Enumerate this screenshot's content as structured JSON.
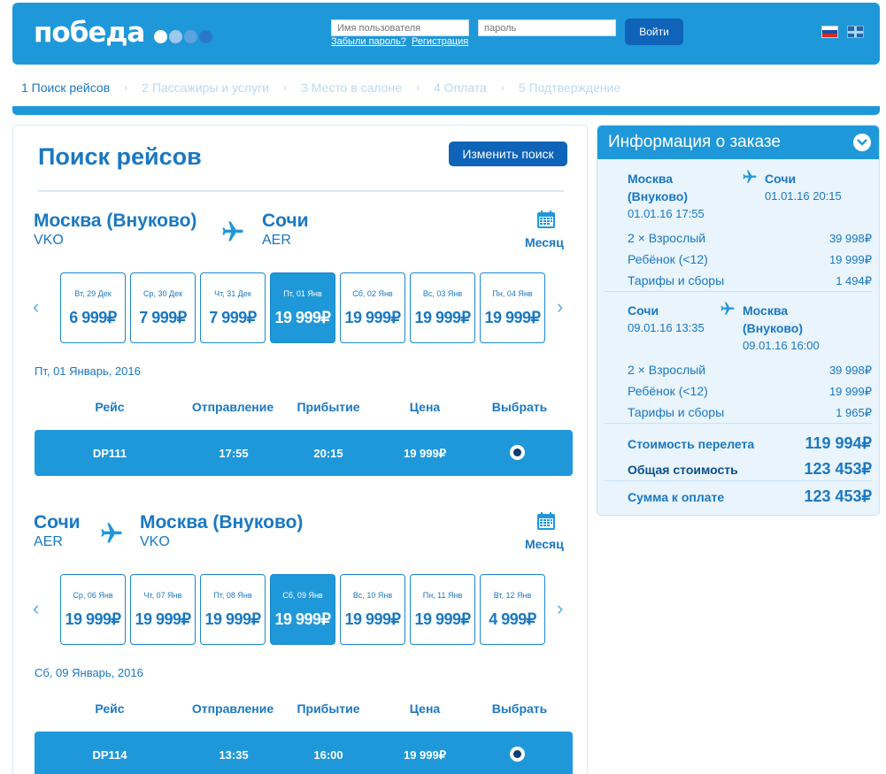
{
  "header": {
    "logo_text": "победа",
    "logo_dot_colors": [
      "#ffffff",
      "#9cc9ee",
      "#5aa3df",
      "#2a79c8"
    ],
    "username_placeholder": "Имя пользователя",
    "password_placeholder": "пароль",
    "forgot_link": "Забыли пароль?",
    "register_link": "Регистрация",
    "login_button": "Войти"
  },
  "steps": [
    {
      "label": "1 Поиск рейсов",
      "active": true
    },
    {
      "label": "2 Пассажиры и услуги",
      "active": false
    },
    {
      "label": "3 Место в салоне",
      "active": false
    },
    {
      "label": "4 Оплата",
      "active": false
    },
    {
      "label": "5 Подтверждение",
      "active": false
    }
  ],
  "main": {
    "title": "Поиск рейсов",
    "change_search_button": "Изменить поиск",
    "column_headers": {
      "flight": "Рейс",
      "departure": "Отправление",
      "arrival": "Прибытие",
      "price": "Цена",
      "select": "Выбрать"
    },
    "routes": [
      {
        "from_city": "Москва (Внуково)",
        "from_code": "VKO",
        "to_city": "Сочи",
        "to_code": "AER",
        "calendar_label": "Месяц",
        "days": [
          {
            "date": "Вт, 29 Дек",
            "price": "6 999₽",
            "selected": false
          },
          {
            "date": "Ср, 30 Дек",
            "price": "7 999₽",
            "selected": false
          },
          {
            "date": "Чт, 31 Дек",
            "price": "7 999₽",
            "selected": false
          },
          {
            "date": "Пт, 01 Янв",
            "price": "19 999₽",
            "selected": true
          },
          {
            "date": "Сб, 02 Янв",
            "price": "19 999₽",
            "selected": false
          },
          {
            "date": "Вс, 03 Янв",
            "price": "19 999₽",
            "selected": false
          },
          {
            "date": "Пн, 04 Янв",
            "price": "19 999₽",
            "selected": false
          }
        ],
        "selected_date": "Пт, 01 Январь, 2016",
        "flight": {
          "number": "DP111",
          "departure": "17:55",
          "arrival": "20:15",
          "price": "19 999₽"
        }
      },
      {
        "from_city": "Сочи",
        "from_code": "AER",
        "to_city": "Москва (Внуково)",
        "to_code": "VKO",
        "calendar_label": "Месяц",
        "days": [
          {
            "date": "Ср, 06 Янв",
            "price": "19 999₽",
            "selected": false
          },
          {
            "date": "Чт, 07 Янв",
            "price": "19 999₽",
            "selected": false
          },
          {
            "date": "Пт, 08 Янв",
            "price": "19 999₽",
            "selected": false
          },
          {
            "date": "Сб, 09 Янв",
            "price": "19 999₽",
            "selected": true
          },
          {
            "date": "Вс, 10 Янв",
            "price": "19 999₽",
            "selected": false
          },
          {
            "date": "Пн, 11 Янв",
            "price": "19 999₽",
            "selected": false
          },
          {
            "date": "Вт, 12 Янв",
            "price": "4 999₽",
            "selected": false
          }
        ],
        "selected_date": "Сб, 09 Январь, 2016",
        "flight": {
          "number": "DP114",
          "departure": "13:35",
          "arrival": "16:00",
          "price": "19 999₽"
        }
      }
    ]
  },
  "order": {
    "title": "Информация о заказе",
    "legs": [
      {
        "from_city_1": "Москва",
        "from_city_2": "(Внуково)",
        "from_datetime": "01.01.16 17:55",
        "to_city_1": "Сочи",
        "to_city_2": "",
        "to_datetime": "01.01.16 20:15",
        "rows": [
          {
            "label": "2 × Взрослый",
            "value": "39 998₽"
          },
          {
            "label": "Ребёнок (<12)",
            "value": "19 999₽"
          },
          {
            "label": "Тарифы и сборы",
            "value": "1 494₽"
          }
        ]
      },
      {
        "from_city_1": "Сочи",
        "from_city_2": "",
        "from_datetime": "09.01.16 13:35",
        "to_city_1": "Москва",
        "to_city_2": "(Внуково)",
        "to_datetime": "09.01.16 16:00",
        "rows": [
          {
            "label": "2 × Взрослый",
            "value": "39 998₽"
          },
          {
            "label": "Ребёнок (<12)",
            "value": "19 999₽"
          },
          {
            "label": "Тарифы и сборы",
            "value": "1 965₽"
          }
        ]
      }
    ],
    "flight_cost_label": "Стоимость перелета",
    "flight_cost_value": "119 994₽",
    "total_label": "Общая стоимость",
    "total_value": "123 453₽",
    "to_pay_label": "Сумма к оплате",
    "to_pay_value": "123 453₽"
  },
  "icons": {
    "plane": "plane-icon",
    "calendar": "calendar-icon",
    "chevron": "chevron-down-icon",
    "prev": "chevron-left-icon",
    "next": "chevron-right-icon"
  },
  "colors": {
    "brand_blue": "#1f98da",
    "dark_blue": "#0f63b8",
    "text_blue": "#1a78c2",
    "panel_bg": "#e9f4fc"
  }
}
